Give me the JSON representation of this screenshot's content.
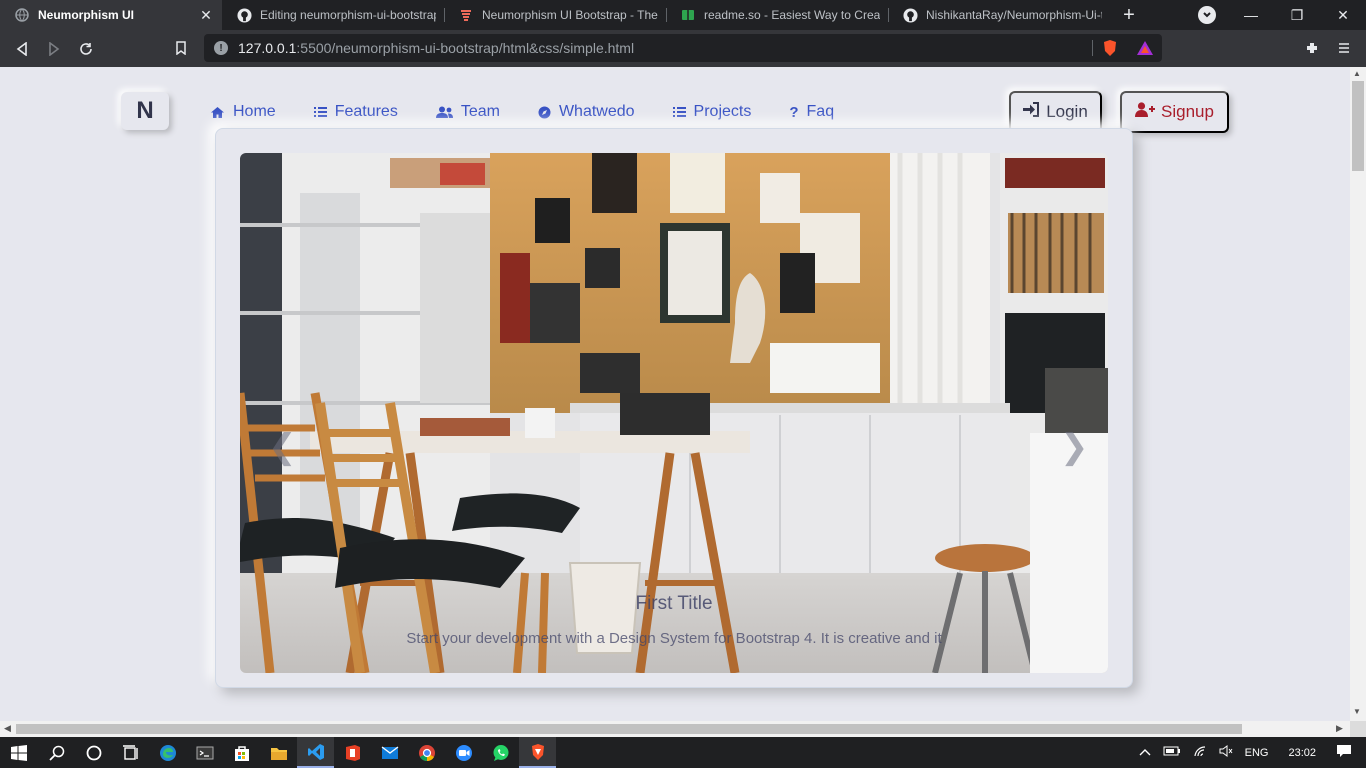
{
  "browser": {
    "tabs": [
      {
        "title": "Neumorphism UI",
        "icon": "globe-icon",
        "active": true
      },
      {
        "title": "Editing neumorphism-ui-bootstrap",
        "icon": "github-icon",
        "active": false
      },
      {
        "title": "Neumorphism UI Bootstrap - Them",
        "icon": "themesberg-icon",
        "active": false
      },
      {
        "title": "readme.so - Easiest Way to Create",
        "icon": "book-icon",
        "active": false
      },
      {
        "title": "NishikantaRay/Neumorphism-Ui-te",
        "icon": "github-icon",
        "active": false
      }
    ],
    "new_tab": "+",
    "url_host": "127.0.0.1",
    "url_rest": ":5500/neumorphism-ui-bootstrap/html&css/simple.html"
  },
  "site": {
    "brand": "N",
    "nav": [
      {
        "label": "Home",
        "icon": "home-icon"
      },
      {
        "label": "Features",
        "icon": "list-icon"
      },
      {
        "label": "Team",
        "icon": "users-icon"
      },
      {
        "label": "Whatwedo",
        "icon": "compass-icon"
      },
      {
        "label": "Projects",
        "icon": "list-icon"
      },
      {
        "label": "Faq",
        "icon": "question-icon"
      }
    ],
    "login_label": "Login",
    "signup_label": "Signup",
    "carousel": {
      "title": "First Title",
      "text": "Start your development with a Design System for Bootstrap 4. It is creative and it"
    }
  },
  "taskbar": {
    "language": "ENG",
    "time": "23:02"
  },
  "colors": {
    "page_bg": "#e6e7ee",
    "nav_link": "#3852c4",
    "signup": "#a91e2c",
    "text_dark": "#31344b"
  }
}
